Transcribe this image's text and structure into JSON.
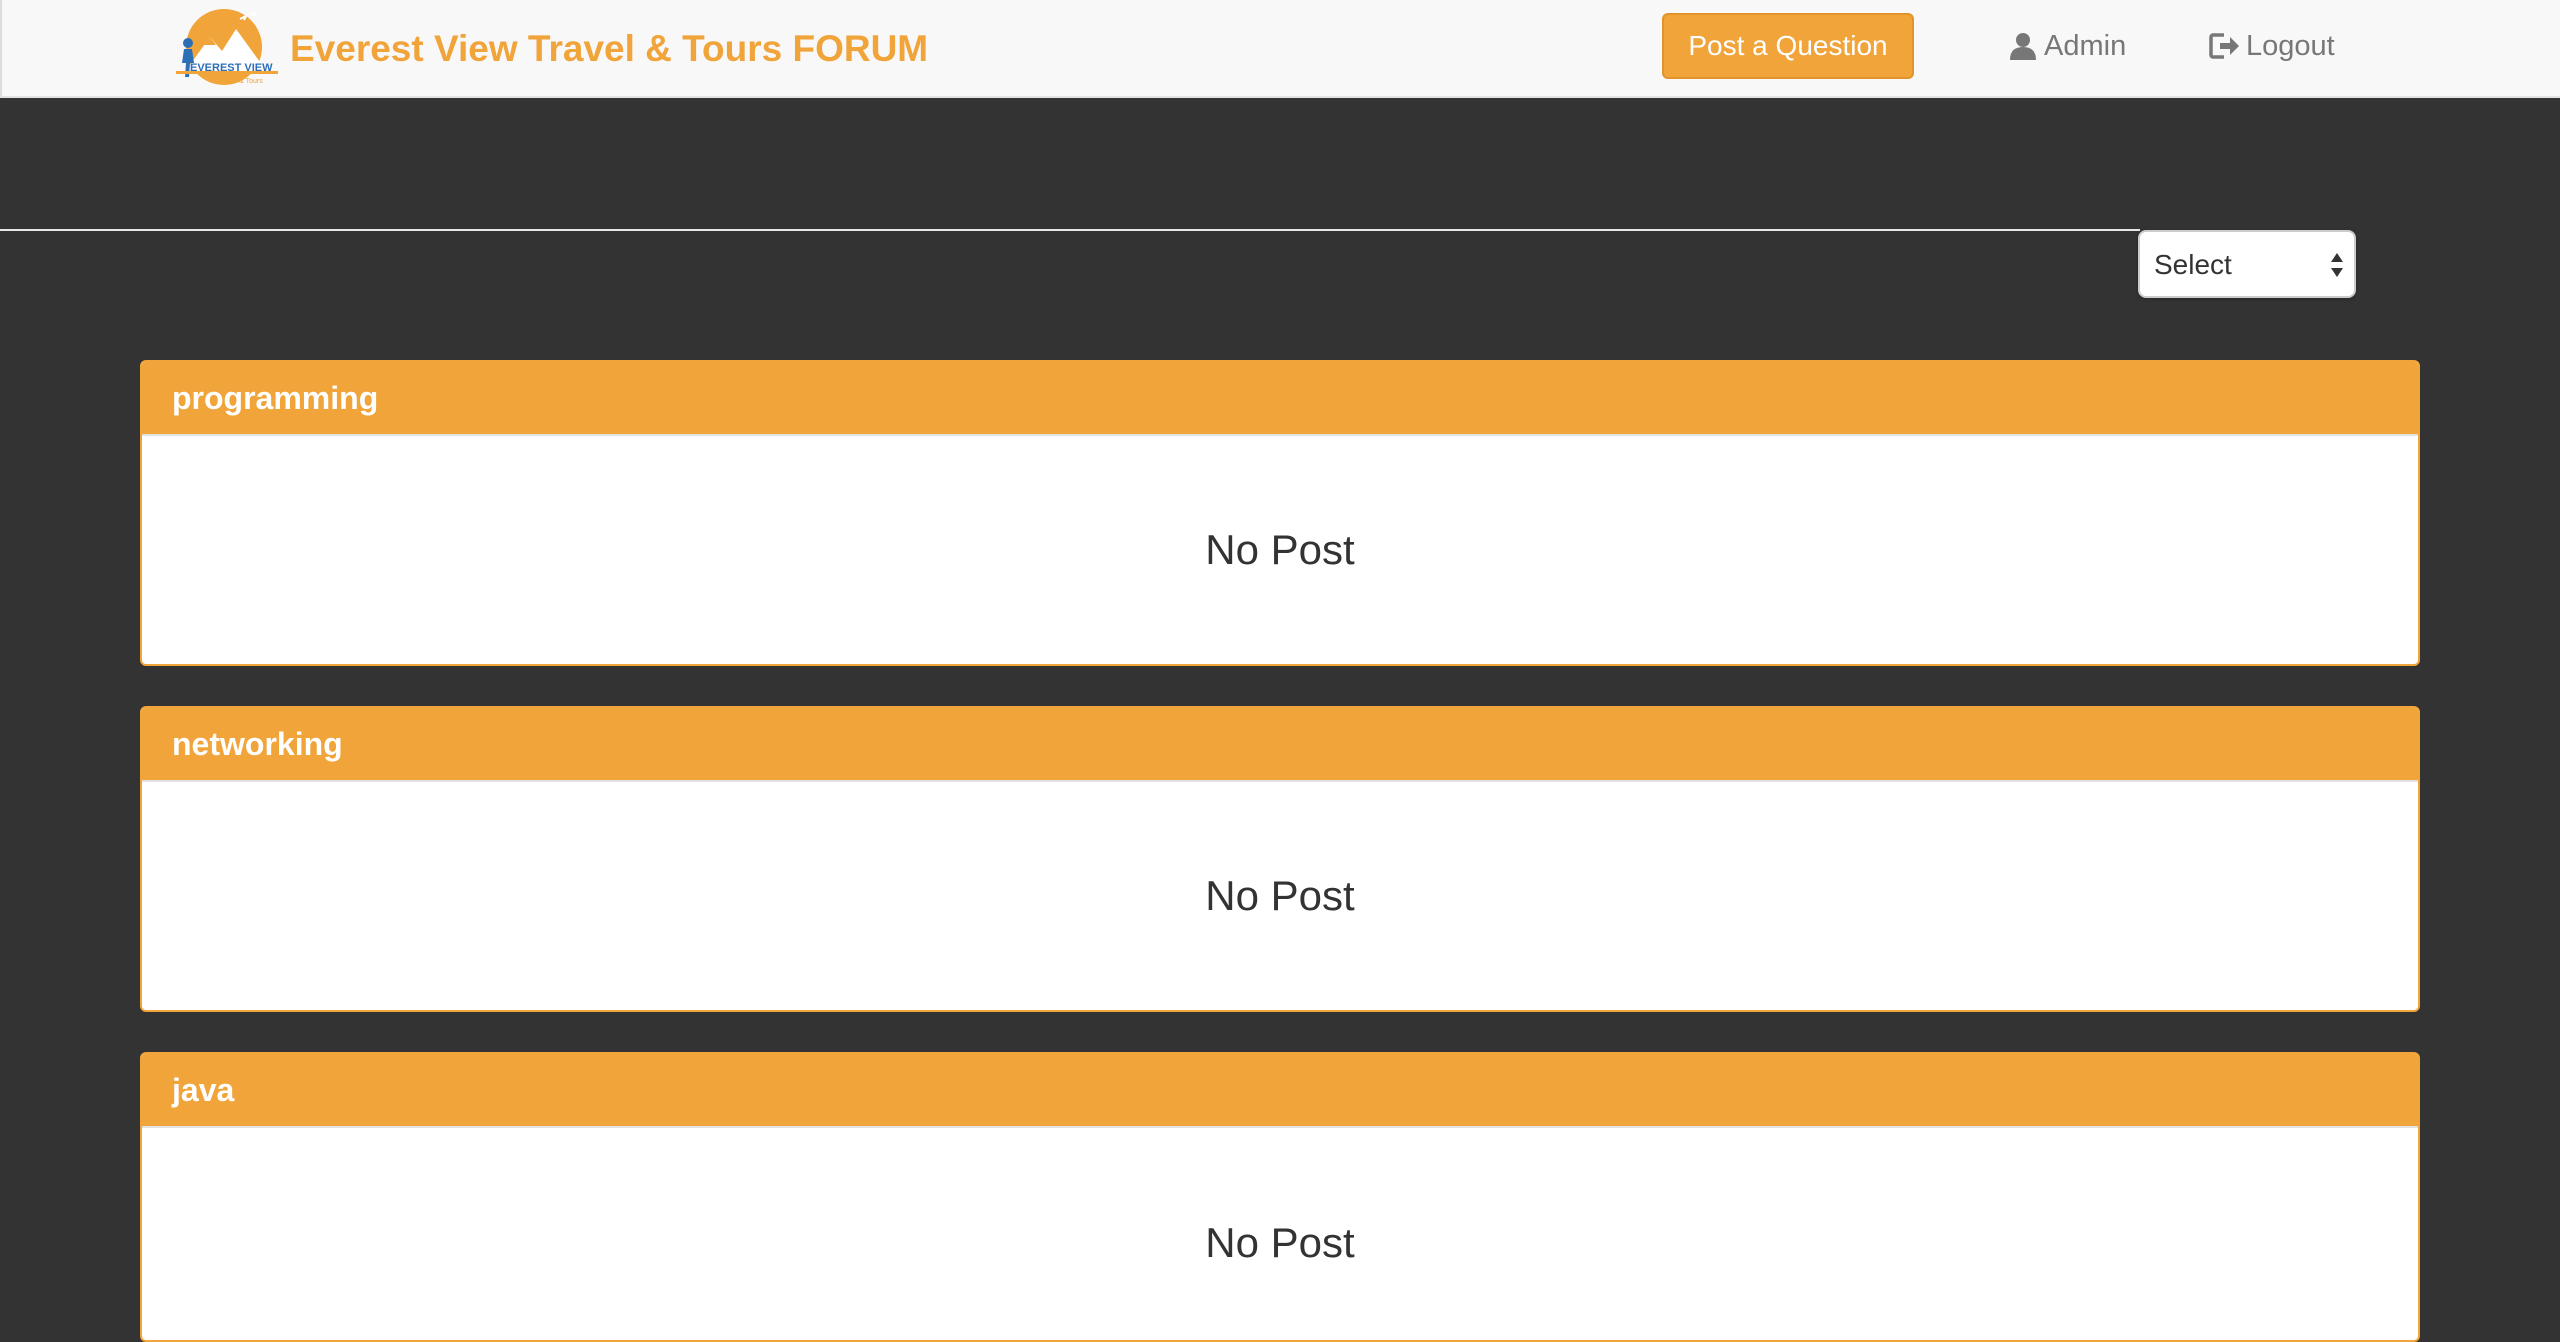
{
  "navbar": {
    "brand_title": "Everest View Travel & Tours FORUM",
    "logo": {
      "icon": "everest-view-logo",
      "text": "EVEREST VIEW",
      "subtext": "Travel & Tours",
      "colors": {
        "orange": "#f0a43a",
        "blue": "#2d6fb7"
      }
    },
    "post_button_label": "Post a Question",
    "admin_label": "Admin",
    "admin_icon": "user-icon",
    "logout_label": "Logout",
    "logout_icon": "logout-icon"
  },
  "filter": {
    "selected": "Select"
  },
  "categories": [
    {
      "name": "programming",
      "empty_text": "No Post"
    },
    {
      "name": "networking",
      "empty_text": "No Post"
    },
    {
      "name": "java",
      "empty_text": "No Post"
    }
  ],
  "colors": {
    "accent": "#f0a43a",
    "page_background": "#333333",
    "navbar_background": "#f8f8f8"
  }
}
